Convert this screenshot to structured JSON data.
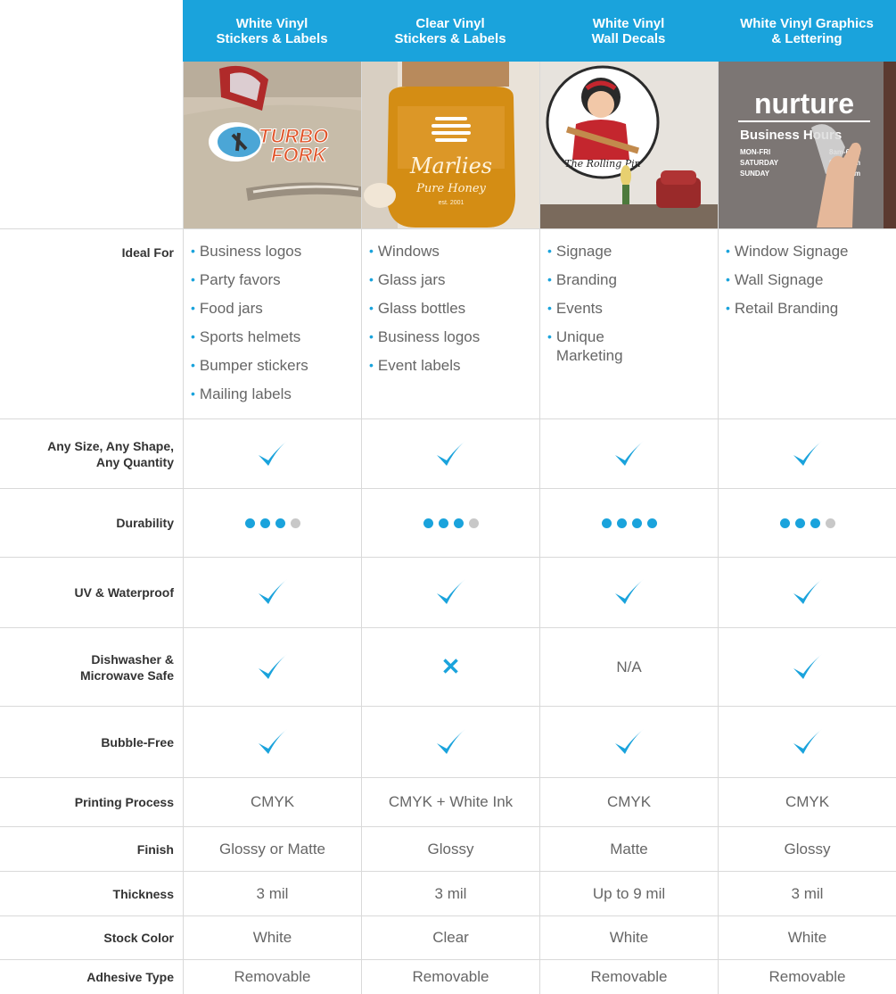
{
  "colors": {
    "accent": "#1aa3dc",
    "dot_off": "#c8c8c8",
    "header_text": "#ffffff"
  },
  "columns": [
    {
      "title_line1": "White Vinyl",
      "title_line2": "Stickers & Labels"
    },
    {
      "title_line1": "Clear Vinyl",
      "title_line2": "Stickers & Labels"
    },
    {
      "title_line1": "White Vinyl",
      "title_line2": "Wall Decals"
    },
    {
      "title_line1": "White Vinyl Graphics",
      "title_line2": "& Lettering"
    }
  ],
  "images": {
    "col1": {
      "brand_line1": "TURBO",
      "brand_line2": "FORK"
    },
    "col2": {
      "brand_line1": "Marlies",
      "brand_line2": "Pure Honey",
      "brand_line3": "est. 2001"
    },
    "col3": {
      "brand": "The Rolling Pin"
    },
    "col4": {
      "brand": "nurture",
      "line1": "Business Hours",
      "row1_label": "MON-FRI",
      "row1_value": "8am-6pm",
      "row2_label": "SATURDAY",
      "row2_value": "9am-6pm",
      "row3_label": "SUNDAY",
      "row3_value": "9am-5pm"
    }
  },
  "rows": {
    "ideal_for": {
      "label": "Ideal For",
      "values": [
        [
          "Business logos",
          "Party favors",
          "Food jars",
          "Sports helmets",
          "Bumper stickers",
          "Mailing labels"
        ],
        [
          "Windows",
          "Glass jars",
          "Glass bottles",
          "Business logos",
          "Event labels"
        ],
        [
          "Signage",
          "Branding",
          "Events",
          "Unique Marketing"
        ],
        [
          "Window Signage",
          "Wall Signage",
          "Retail Branding"
        ]
      ]
    },
    "any_size": {
      "label_line1": "Any Size, Any Shape,",
      "label_line2": "Any Quantity",
      "values": [
        "check",
        "check",
        "check",
        "check"
      ]
    },
    "durability": {
      "label": "Durability",
      "values": [
        3,
        3,
        4,
        3
      ],
      "max": 4
    },
    "uv": {
      "label": "UV & Waterproof",
      "values": [
        "check",
        "check",
        "check",
        "check"
      ]
    },
    "dishwasher": {
      "label_line1": "Dishwasher &",
      "label_line2": "Microwave Safe",
      "values": [
        "check",
        "cross",
        "N/A",
        "check"
      ]
    },
    "bubble": {
      "label": "Bubble-Free",
      "values": [
        "check",
        "check",
        "check",
        "check"
      ]
    },
    "printing": {
      "label": "Printing Process",
      "values": [
        "CMYK",
        "CMYK + White Ink",
        "CMYK",
        "CMYK"
      ]
    },
    "finish": {
      "label": "Finish",
      "values": [
        "Glossy or Matte",
        "Glossy",
        "Matte",
        "Glossy"
      ]
    },
    "thickness": {
      "label": "Thickness",
      "values": [
        "3 mil",
        "3 mil",
        "Up to 9 mil",
        "3 mil"
      ]
    },
    "stock": {
      "label": "Stock Color",
      "values": [
        "White",
        "Clear",
        "White",
        "White"
      ]
    },
    "adhesive": {
      "label": "Adhesive Type",
      "values": [
        "Removable",
        "Removable",
        "Removable",
        "Removable"
      ]
    }
  }
}
